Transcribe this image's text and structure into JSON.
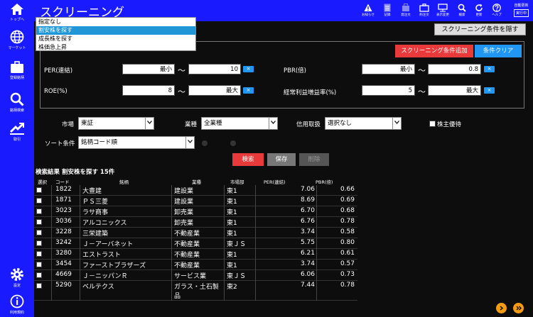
{
  "sidebar": {
    "items": [
      {
        "label": "トップへ",
        "icon": "home-icon"
      },
      {
        "label": "マーケット",
        "icon": "globe-icon"
      },
      {
        "label": "登録銘柄",
        "icon": "briefcase-icon"
      },
      {
        "label": "銘柄検索",
        "icon": "search-icon"
      },
      {
        "label": "取引",
        "icon": "trade-icon"
      }
    ],
    "bottom": [
      {
        "label": "設定",
        "icon": "gear-icon"
      },
      {
        "label": "利用規約",
        "icon": "info-icon"
      }
    ]
  },
  "header": {
    "title": "スクリーニング",
    "toolbar": [
      "お知らせ",
      "記録",
      "発注文",
      "約注文",
      "表示変更",
      "検索",
      "更新",
      "ヘルプ"
    ],
    "auto_update_label": "自動更新",
    "auto_update_state": "実行中"
  },
  "dropdown": {
    "options": [
      "指定なし",
      "割安株を探す",
      "成長株を探す",
      "株価急上昇"
    ],
    "selected": 1
  },
  "hide_conditions_label": "スクリーニング条件を隠す",
  "conditions": {
    "add_label": "スクリーニング条件追加",
    "clear_label": "条件クリア",
    "tilde": "～",
    "remove_label": "×",
    "rows": [
      {
        "label": "PER(連結)",
        "min": "最小",
        "max": "10"
      },
      {
        "label": "PBR(倍)",
        "min": "最小",
        "max": "0.8"
      },
      {
        "label": "ROE(%)",
        "min": "8",
        "max": "最大"
      },
      {
        "label": "経常利益増益率(%)",
        "min": "5",
        "max": "最大"
      }
    ]
  },
  "filters": {
    "market_label": "市場",
    "market_value": "東証",
    "industry_label": "業種",
    "industry_value": "全業種",
    "credit_label": "信用取扱",
    "credit_value": "選択なし",
    "benefit_label": "株主優待",
    "sort_label": "ソート条件",
    "sort_value": "銘柄コード順"
  },
  "actions": {
    "search_label": "検索",
    "save_label": "保存",
    "delete_label": "削除"
  },
  "results": {
    "title": "検索結果 割安株を探す 15件",
    "columns": [
      "選択",
      "コード",
      "銘柄",
      "業種",
      "市場部",
      "PER(連結)",
      "PBR(倍)"
    ],
    "rows": [
      {
        "code": "1822",
        "name": "大豊建",
        "industry": "建設業",
        "market": "東1",
        "per": "7.06",
        "pbr": "0.66"
      },
      {
        "code": "1871",
        "name": "ＰＳ三菱",
        "industry": "建設業",
        "market": "東1",
        "per": "8.69",
        "pbr": "0.69"
      },
      {
        "code": "3023",
        "name": "ラサ商事",
        "industry": "卸売業",
        "market": "東1",
        "per": "6.70",
        "pbr": "0.68"
      },
      {
        "code": "3036",
        "name": "アルコニックス",
        "industry": "卸売業",
        "market": "東1",
        "per": "6.76",
        "pbr": "0.78"
      },
      {
        "code": "3228",
        "name": "三栄建築",
        "industry": "不動産業",
        "market": "東1",
        "per": "3.74",
        "pbr": "0.58"
      },
      {
        "code": "3242",
        "name": "Ｊ－アーバネット",
        "industry": "不動産業",
        "market": "東ＪＳ",
        "per": "5.75",
        "pbr": "0.80"
      },
      {
        "code": "3280",
        "name": "エストラスト",
        "industry": "不動産業",
        "market": "東1",
        "per": "6.21",
        "pbr": "0.61"
      },
      {
        "code": "3454",
        "name": "ファーストブラザーズ",
        "industry": "不動産業",
        "market": "東1",
        "per": "3.74",
        "pbr": "0.57"
      },
      {
        "code": "4669",
        "name": "Ｊ－ニッパンＲ",
        "industry": "サービス業",
        "market": "東ＪＳ",
        "per": "6.06",
        "pbr": "0.73"
      },
      {
        "code": "5290",
        "name": "ベルテクス",
        "industry": "ガラス・土石製",
        "industry2": "品",
        "market": "東2",
        "per": "7.44",
        "pbr": "0.78"
      }
    ]
  }
}
